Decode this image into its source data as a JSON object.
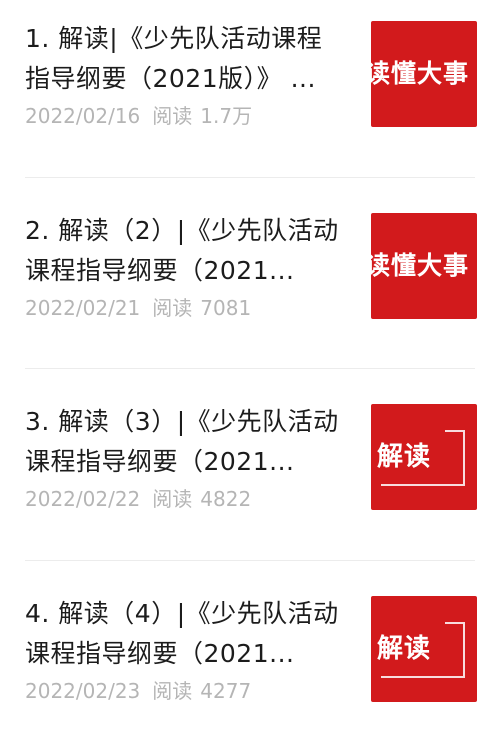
{
  "articles": [
    {
      "title": "1. 解读|《少先队活动课程指导纲要（2021版）》 ...",
      "date": "2022/02/16",
      "read_label": "阅读",
      "read_count": "1.7万",
      "thumb_text": "读懂大事"
    },
    {
      "title": "2. 解读（2）|《少先队活动课程指导纲要（2021...",
      "date": "2022/02/21",
      "read_label": "阅读",
      "read_count": "7081",
      "thumb_text": "读懂大事"
    },
    {
      "title": "3. 解读（3）|《少先队活动课程指导纲要（2021...",
      "date": "2022/02/22",
      "read_label": "阅读",
      "read_count": "4822",
      "thumb_text": "解读"
    },
    {
      "title": "4. 解读（4）|《少先队活动课程指导纲要（2021...",
      "date": "2022/02/23",
      "read_label": "阅读",
      "read_count": "4277",
      "thumb_text": "解读"
    }
  ],
  "colors": {
    "thumb_red": "#d21a1c",
    "title_text": "#1c1c1c",
    "meta_text": "#b5b5b5"
  }
}
